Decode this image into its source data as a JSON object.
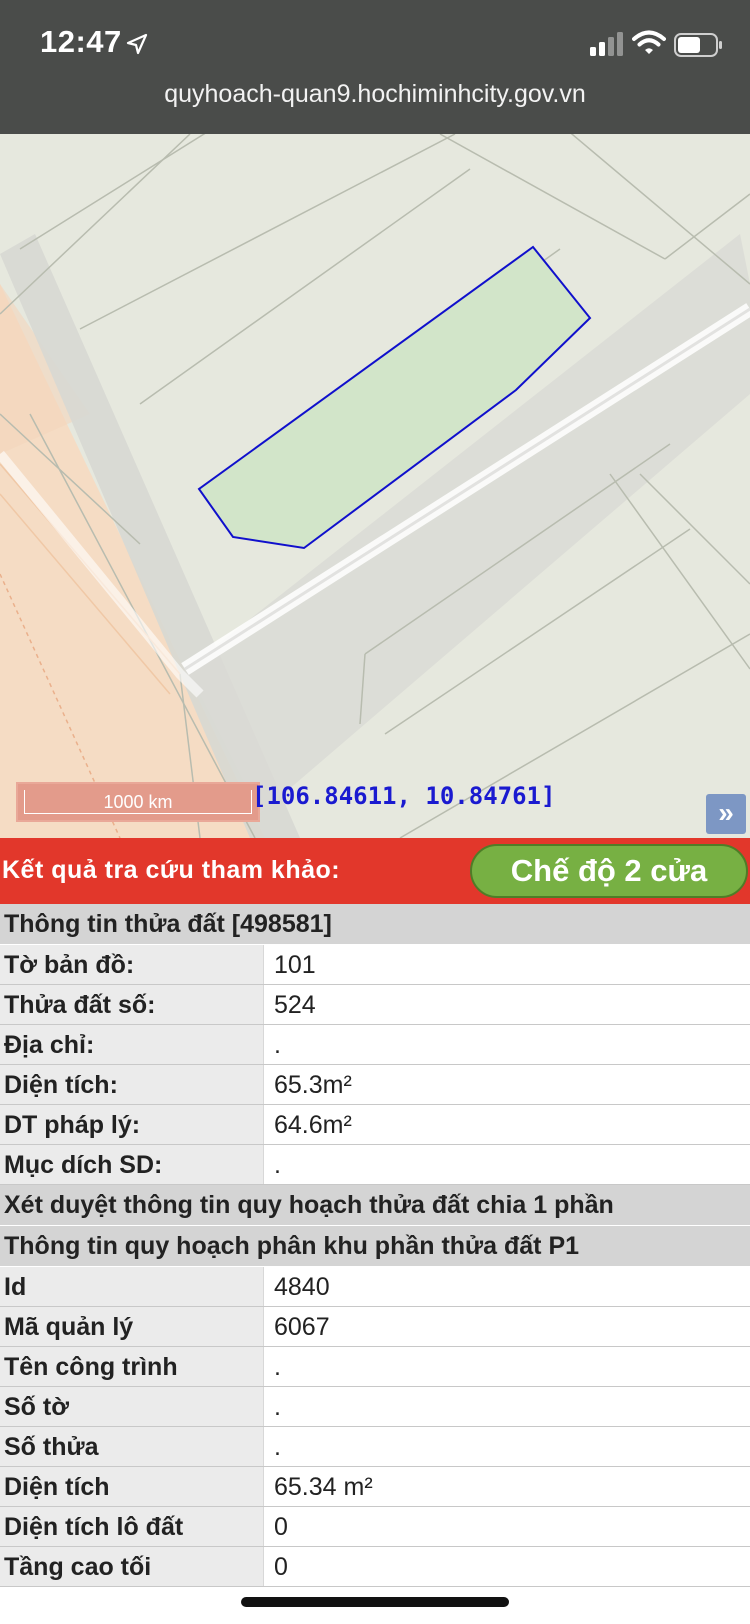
{
  "status_bar": {
    "time": "12:47",
    "url": "quyhoach-quan9.hochiminhcity.gov.vn",
    "icons": [
      "location-arrow-icon",
      "cellular-signal-icon",
      "wifi-icon",
      "battery-icon"
    ]
  },
  "map": {
    "scale_label": "1000 km",
    "coordinates": "[106.84611, 10.84761]",
    "expand_glyph": "»",
    "colors": {
      "parcel_fill": "#d2e5c9",
      "parcel_outline": "#1010cc",
      "zone_orange": "#f5dcc4",
      "road": "#d9dad5"
    }
  },
  "result_bar": {
    "title": "Kết quả tra cứu tham khảo:",
    "mode_button": "Chế độ 2 cửa",
    "color": "#e2372b"
  },
  "parcel_info": {
    "header": "Thông tin thửa đất [498581]",
    "rows": [
      {
        "label": "Tờ bản đồ:",
        "value": "101"
      },
      {
        "label": "Thửa đất số:",
        "value": "524"
      },
      {
        "label": "Địa chỉ:",
        "value": "."
      },
      {
        "label": "Diện tích:",
        "value": "65.3m²"
      },
      {
        "label": "DT pháp lý:",
        "value": "64.6m²"
      },
      {
        "label": "Mục dích SD:",
        "value": "."
      }
    ]
  },
  "review_header": "Xét duyệt thông tin quy hoạch thửa đất chia 1 phần",
  "plan_info": {
    "header": "Thông tin quy hoạch phân khu phần thửa đất P1",
    "rows": [
      {
        "label": "Id",
        "value": "4840"
      },
      {
        "label": "Mã quản lý",
        "value": "6067"
      },
      {
        "label": "Tên công trình",
        "value": "."
      },
      {
        "label": "Số tờ",
        "value": "."
      },
      {
        "label": "Số thửa",
        "value": "."
      },
      {
        "label": "Diện tích",
        "value": "65.34 m²"
      },
      {
        "label": "Diện tích lô đất",
        "value": "0"
      },
      {
        "label": "Tầng cao tối",
        "value": "0"
      }
    ]
  }
}
